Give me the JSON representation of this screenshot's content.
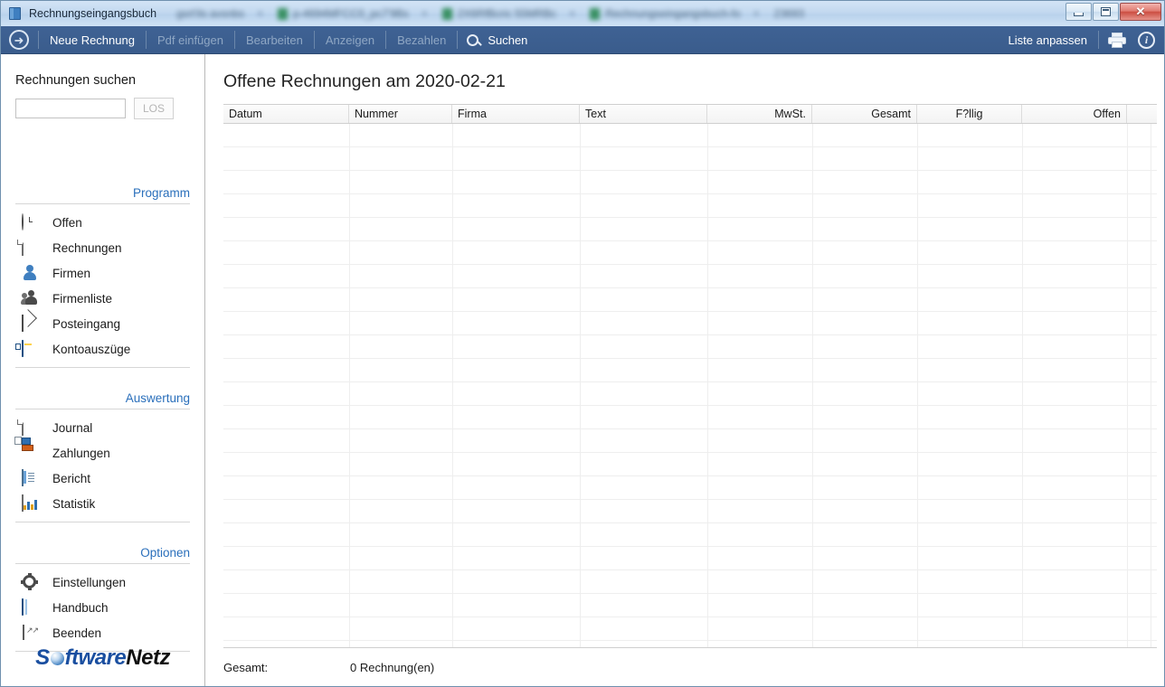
{
  "window": {
    "title": "Rechnungseingangsbuch",
    "icon": "book-icon",
    "buttons": {
      "minimize": "minimize-icon",
      "restore": "restore-icon",
      "close": "✕"
    },
    "background_tabs": [
      {
        "title": "gsrt'ils avsnbs",
        "icon": "none"
      },
      {
        "title": "p-4694MFCC0_pc7'9Bs",
        "icon": "pdf-icon"
      },
      {
        "title": "2X6RfBcric 55MRBc",
        "icon": "pdf-icon"
      },
      {
        "title": "Rechnungseingangsbuch-fo",
        "icon": "pdf-icon"
      },
      {
        "title": "23693",
        "icon": "none"
      }
    ]
  },
  "toolbar": {
    "back": "back-icon",
    "items": [
      {
        "label": "Neue Rechnung",
        "enabled": true
      },
      {
        "label": "Pdf einfügen",
        "enabled": false
      },
      {
        "label": "Bearbeiten",
        "enabled": false
      },
      {
        "label": "Anzeigen",
        "enabled": false
      },
      {
        "label": "Bezahlen",
        "enabled": false
      }
    ],
    "search_label": "Suchen",
    "customize_label": "Liste anpassen",
    "print_icon": "printer-icon",
    "info_icon": "info-icon"
  },
  "sidebar": {
    "search": {
      "label": "Rechnungen suchen",
      "value": "",
      "placeholder": "",
      "button_label": "LOS",
      "button_enabled": false
    },
    "groups": [
      {
        "title": "Programm",
        "items": [
          {
            "label": "Offen",
            "icon": "clock-icon"
          },
          {
            "label": "Rechnungen",
            "icon": "document-icon"
          },
          {
            "label": "Firmen",
            "icon": "person-icon"
          },
          {
            "label": "Firmenliste",
            "icon": "people-icon"
          },
          {
            "label": "Posteingang",
            "icon": "envelope-icon"
          },
          {
            "label": "Kontoauszüge",
            "icon": "bank-card-icon"
          }
        ]
      },
      {
        "title": "Auswertung",
        "items": [
          {
            "label": "Journal",
            "icon": "document-icon"
          },
          {
            "label": "Zahlungen",
            "icon": "payment-icon"
          },
          {
            "label": "Bericht",
            "icon": "report-icon"
          },
          {
            "label": "Statistik",
            "icon": "chart-icon"
          }
        ]
      },
      {
        "title": "Optionen",
        "items": [
          {
            "label": "Einstellungen",
            "icon": "gear-icon"
          },
          {
            "label": "Handbuch",
            "icon": "book-icon"
          },
          {
            "label": "Beenden",
            "icon": "exit-icon"
          }
        ]
      }
    ],
    "logo": {
      "part1": "S",
      "part2": "ftware",
      "part3": "Netz"
    }
  },
  "main": {
    "page_title": "Offene Rechnungen am 2020-02-21",
    "columns": [
      {
        "label": "Datum",
        "width": 139,
        "align": "left"
      },
      {
        "label": "Nummer",
        "width": 114,
        "align": "left"
      },
      {
        "label": "Firma",
        "width": 141,
        "align": "left"
      },
      {
        "label": "Text",
        "width": 141,
        "align": "left"
      },
      {
        "label": "MwSt.",
        "width": 116,
        "align": "right"
      },
      {
        "label": "Gesamt",
        "width": 116,
        "align": "right"
      },
      {
        "label": "F?llig",
        "width": 116,
        "align": "left"
      },
      {
        "label": "Offen",
        "width": 116,
        "align": "right"
      },
      {
        "label": "",
        "width": 26,
        "align": "left"
      }
    ],
    "rows": [],
    "footer": {
      "label": "Gesamt:",
      "value": "0 Rechnung(en)"
    }
  },
  "colors": {
    "toolbar_bg": "#3f6294",
    "accent": "#2a6fbb",
    "title_bg": "#c2d8ef",
    "grid_line": "#eeeeee"
  }
}
